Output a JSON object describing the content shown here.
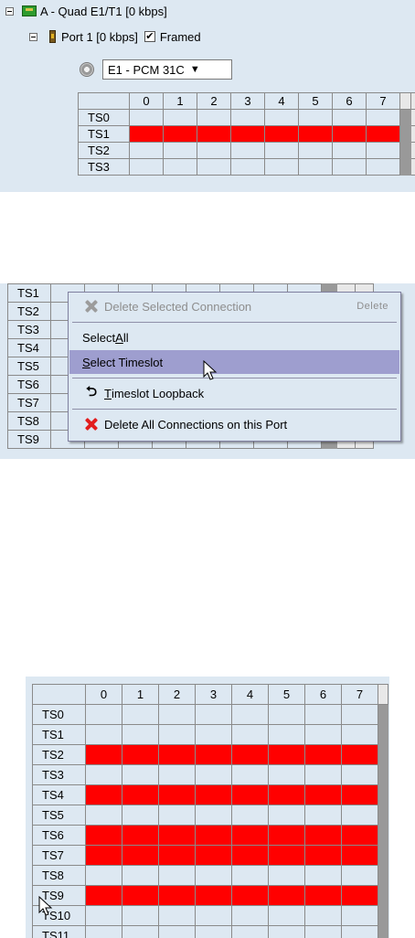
{
  "panel1": {
    "card_label": "A - Quad E1/T1 [0 kbps]",
    "port_label": "Port 1 [0 kbps]",
    "framed_label": "Framed",
    "framed_check": "✔",
    "framing_select": "E1 - PCM 31C",
    "columns": [
      "0",
      "1",
      "2",
      "3",
      "4",
      "5",
      "6",
      "7"
    ],
    "rows": [
      {
        "label": "TS0",
        "cells": [
          "sel",
          "sel",
          "sel",
          "",
          "",
          "",
          "",
          ""
        ]
      },
      {
        "label": "TS1",
        "cells": [
          "red",
          "red",
          "red",
          "red",
          "red",
          "red",
          "red",
          "red"
        ]
      },
      {
        "label": "TS2",
        "cells": [
          "",
          "",
          "",
          "",
          "",
          "",
          "",
          ""
        ]
      },
      {
        "label": "TS3",
        "cells": [
          "",
          "",
          "",
          "",
          "",
          "",
          "",
          ""
        ]
      }
    ]
  },
  "panel2": {
    "rows": [
      "TS1",
      "TS2",
      "TS3",
      "TS4",
      "TS5",
      "TS6",
      "TS7",
      "TS8",
      "TS9"
    ],
    "menu": {
      "delete_selected": "Delete Selected Connection",
      "delete_shortcut": "Delete",
      "select_all_pre": "Select ",
      "select_all_mn": "A",
      "select_all_post": "ll",
      "select_ts_mn": "S",
      "select_ts_post": "elect Timeslot",
      "loopback_mn": "T",
      "loopback_post": "imeslot Loopback",
      "delete_all": "Delete All Connections on this Port"
    }
  },
  "panel3": {
    "columns": [
      "0",
      "1",
      "2",
      "3",
      "4",
      "5",
      "6",
      "7"
    ],
    "rows": [
      {
        "label": "TS0",
        "cells": [
          "sel",
          "sel",
          "sel",
          "",
          "",
          "",
          "",
          ""
        ]
      },
      {
        "label": "TS1",
        "cells": [
          "",
          "",
          "",
          "",
          "",
          "",
          "",
          ""
        ]
      },
      {
        "label": "TS2",
        "cells": [
          "red",
          "red",
          "red",
          "red",
          "red",
          "red",
          "red",
          "red"
        ]
      },
      {
        "label": "TS3",
        "cells": [
          "",
          "",
          "",
          "",
          "",
          "",
          "",
          ""
        ]
      },
      {
        "label": "TS4",
        "cells": [
          "red",
          "red",
          "red",
          "red",
          "red",
          "red",
          "red",
          "red"
        ]
      },
      {
        "label": "TS5",
        "cells": [
          "",
          "",
          "",
          "",
          "",
          "",
          "",
          ""
        ]
      },
      {
        "label": "TS6",
        "cells": [
          "red",
          "red",
          "red",
          "red",
          "red",
          "red",
          "red",
          "red"
        ]
      },
      {
        "label": "TS7",
        "cells": [
          "red",
          "red",
          "red",
          "red",
          "red",
          "red",
          "red",
          "red"
        ]
      },
      {
        "label": "TS8",
        "cells": [
          "",
          "",
          "",
          "",
          "",
          "",
          "",
          ""
        ]
      },
      {
        "label": "TS9",
        "cells": [
          "red",
          "red",
          "red",
          "red",
          "red",
          "red",
          "red",
          "red"
        ]
      },
      {
        "label": "TS10",
        "cells": [
          "",
          "",
          "",
          "",
          "",
          "",
          "",
          ""
        ]
      },
      {
        "label": "TS11",
        "cells": [
          "",
          "",
          "",
          "",
          "",
          "",
          "",
          ""
        ]
      }
    ]
  },
  "colors": {
    "connection": "#ff0000",
    "selection": "#dde8f2",
    "menu_hover": "#9e9ecf",
    "scroll_gray": "#999999"
  }
}
